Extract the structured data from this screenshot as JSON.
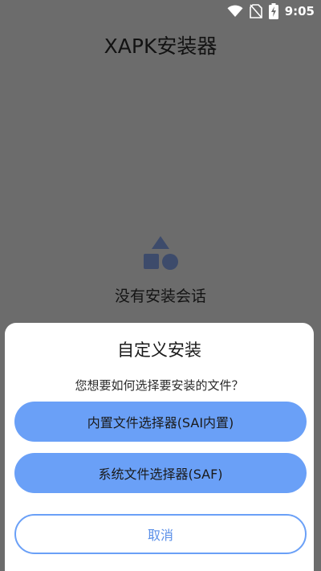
{
  "status_bar": {
    "time": "9:05",
    "icons": [
      "wifi-icon",
      "no-sim-icon",
      "battery-charging-icon"
    ]
  },
  "app": {
    "title": "XAPK安装器"
  },
  "empty_state": {
    "icon": "shapes-icon",
    "text": "没有安装会话",
    "icon_color": "#3d4b6b"
  },
  "dialog": {
    "title": "自定义安装",
    "subtitle": "您想要如何选择要安装的文件？",
    "buttons": {
      "internal_picker": "内置文件选择器(SAI内置)",
      "system_picker": "系统文件选择器(SAF)",
      "cancel": "取消"
    },
    "accent_color": "#6aa0f7"
  }
}
